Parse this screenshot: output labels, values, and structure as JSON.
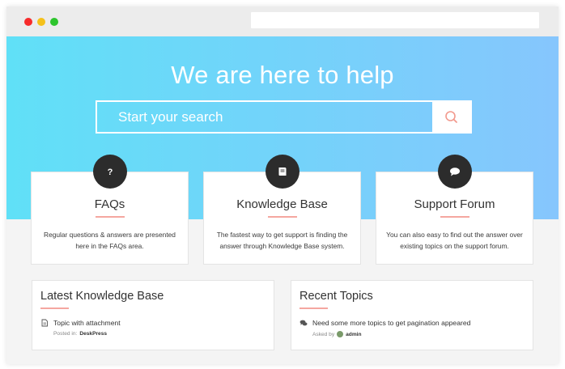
{
  "browser": {
    "url": ""
  },
  "hero": {
    "title": "We are here to help",
    "search_placeholder": "Start your search"
  },
  "cards": [
    {
      "icon": "question-icon",
      "title": "FAQs",
      "description": "Regular questions & answers are presented here in the FAQs area."
    },
    {
      "icon": "book-icon",
      "title": "Knowledge Base",
      "description": "The fastest way to get support is finding the answer through Knowledge Base system."
    },
    {
      "icon": "chat-bubble-icon",
      "title": "Support Forum",
      "description": "You can also easy to find out the answer over existing topics on the support forum."
    }
  ],
  "latest_kb": {
    "title": "Latest Knowledge Base",
    "items": [
      {
        "icon": "document-icon",
        "text": "Topic with attachment",
        "meta_label": "Posted in:",
        "meta_value": "DeskPress"
      }
    ]
  },
  "recent_topics": {
    "title": "Recent Topics",
    "items": [
      {
        "icon": "chat-bubbles-icon",
        "text": "Need some more topics to get pagination appeared",
        "meta_label": "Asked by",
        "meta_value": "admin"
      }
    ]
  },
  "colors": {
    "hero_start": "#60e0f7",
    "hero_end": "#86c6fd",
    "accent": "#f5a7a0",
    "badge": "#2c2c2c"
  }
}
